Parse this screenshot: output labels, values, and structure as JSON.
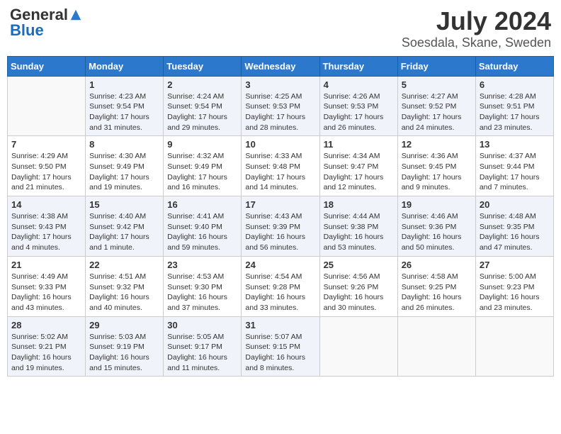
{
  "header": {
    "logo_general": "General",
    "logo_blue": "Blue",
    "main_title": "July 2024",
    "subtitle": "Soesdala, Skane, Sweden"
  },
  "calendar": {
    "days_of_week": [
      "Sunday",
      "Monday",
      "Tuesday",
      "Wednesday",
      "Thursday",
      "Friday",
      "Saturday"
    ],
    "weeks": [
      [
        {
          "day": "",
          "detail": ""
        },
        {
          "day": "1",
          "detail": "Sunrise: 4:23 AM\nSunset: 9:54 PM\nDaylight: 17 hours\nand 31 minutes."
        },
        {
          "day": "2",
          "detail": "Sunrise: 4:24 AM\nSunset: 9:54 PM\nDaylight: 17 hours\nand 29 minutes."
        },
        {
          "day": "3",
          "detail": "Sunrise: 4:25 AM\nSunset: 9:53 PM\nDaylight: 17 hours\nand 28 minutes."
        },
        {
          "day": "4",
          "detail": "Sunrise: 4:26 AM\nSunset: 9:53 PM\nDaylight: 17 hours\nand 26 minutes."
        },
        {
          "day": "5",
          "detail": "Sunrise: 4:27 AM\nSunset: 9:52 PM\nDaylight: 17 hours\nand 24 minutes."
        },
        {
          "day": "6",
          "detail": "Sunrise: 4:28 AM\nSunset: 9:51 PM\nDaylight: 17 hours\nand 23 minutes."
        }
      ],
      [
        {
          "day": "7",
          "detail": "Sunrise: 4:29 AM\nSunset: 9:50 PM\nDaylight: 17 hours\nand 21 minutes."
        },
        {
          "day": "8",
          "detail": "Sunrise: 4:30 AM\nSunset: 9:49 PM\nDaylight: 17 hours\nand 19 minutes."
        },
        {
          "day": "9",
          "detail": "Sunrise: 4:32 AM\nSunset: 9:49 PM\nDaylight: 17 hours\nand 16 minutes."
        },
        {
          "day": "10",
          "detail": "Sunrise: 4:33 AM\nSunset: 9:48 PM\nDaylight: 17 hours\nand 14 minutes."
        },
        {
          "day": "11",
          "detail": "Sunrise: 4:34 AM\nSunset: 9:47 PM\nDaylight: 17 hours\nand 12 minutes."
        },
        {
          "day": "12",
          "detail": "Sunrise: 4:36 AM\nSunset: 9:45 PM\nDaylight: 17 hours\nand 9 minutes."
        },
        {
          "day": "13",
          "detail": "Sunrise: 4:37 AM\nSunset: 9:44 PM\nDaylight: 17 hours\nand 7 minutes."
        }
      ],
      [
        {
          "day": "14",
          "detail": "Sunrise: 4:38 AM\nSunset: 9:43 PM\nDaylight: 17 hours\nand 4 minutes."
        },
        {
          "day": "15",
          "detail": "Sunrise: 4:40 AM\nSunset: 9:42 PM\nDaylight: 17 hours\nand 1 minute."
        },
        {
          "day": "16",
          "detail": "Sunrise: 4:41 AM\nSunset: 9:40 PM\nDaylight: 16 hours\nand 59 minutes."
        },
        {
          "day": "17",
          "detail": "Sunrise: 4:43 AM\nSunset: 9:39 PM\nDaylight: 16 hours\nand 56 minutes."
        },
        {
          "day": "18",
          "detail": "Sunrise: 4:44 AM\nSunset: 9:38 PM\nDaylight: 16 hours\nand 53 minutes."
        },
        {
          "day": "19",
          "detail": "Sunrise: 4:46 AM\nSunset: 9:36 PM\nDaylight: 16 hours\nand 50 minutes."
        },
        {
          "day": "20",
          "detail": "Sunrise: 4:48 AM\nSunset: 9:35 PM\nDaylight: 16 hours\nand 47 minutes."
        }
      ],
      [
        {
          "day": "21",
          "detail": "Sunrise: 4:49 AM\nSunset: 9:33 PM\nDaylight: 16 hours\nand 43 minutes."
        },
        {
          "day": "22",
          "detail": "Sunrise: 4:51 AM\nSunset: 9:32 PM\nDaylight: 16 hours\nand 40 minutes."
        },
        {
          "day": "23",
          "detail": "Sunrise: 4:53 AM\nSunset: 9:30 PM\nDaylight: 16 hours\nand 37 minutes."
        },
        {
          "day": "24",
          "detail": "Sunrise: 4:54 AM\nSunset: 9:28 PM\nDaylight: 16 hours\nand 33 minutes."
        },
        {
          "day": "25",
          "detail": "Sunrise: 4:56 AM\nSunset: 9:26 PM\nDaylight: 16 hours\nand 30 minutes."
        },
        {
          "day": "26",
          "detail": "Sunrise: 4:58 AM\nSunset: 9:25 PM\nDaylight: 16 hours\nand 26 minutes."
        },
        {
          "day": "27",
          "detail": "Sunrise: 5:00 AM\nSunset: 9:23 PM\nDaylight: 16 hours\nand 23 minutes."
        }
      ],
      [
        {
          "day": "28",
          "detail": "Sunrise: 5:02 AM\nSunset: 9:21 PM\nDaylight: 16 hours\nand 19 minutes."
        },
        {
          "day": "29",
          "detail": "Sunrise: 5:03 AM\nSunset: 9:19 PM\nDaylight: 16 hours\nand 15 minutes."
        },
        {
          "day": "30",
          "detail": "Sunrise: 5:05 AM\nSunset: 9:17 PM\nDaylight: 16 hours\nand 11 minutes."
        },
        {
          "day": "31",
          "detail": "Sunrise: 5:07 AM\nSunset: 9:15 PM\nDaylight: 16 hours\nand 8 minutes."
        },
        {
          "day": "",
          "detail": ""
        },
        {
          "day": "",
          "detail": ""
        },
        {
          "day": "",
          "detail": ""
        }
      ]
    ]
  }
}
